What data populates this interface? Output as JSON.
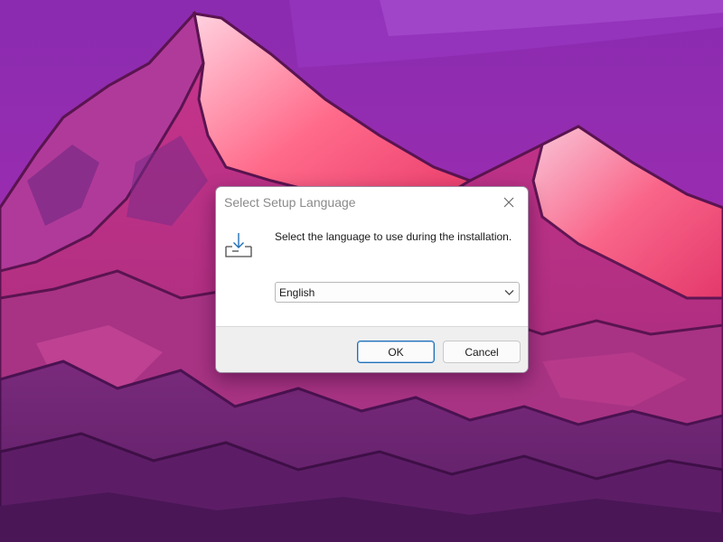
{
  "dialog": {
    "title": "Select Setup Language",
    "prompt": "Select the language to use during the installation.",
    "language_select": {
      "selected": "English"
    },
    "buttons": {
      "ok_label": "OK",
      "cancel_label": "Cancel"
    },
    "icons": {
      "close": "close-icon",
      "setup": "download-tray-icon",
      "dropdown": "chevron-down-icon"
    }
  },
  "colors": {
    "accent": "#1e6fb8",
    "footer_bg": "#efefef",
    "title_text": "#8a8a8a"
  }
}
